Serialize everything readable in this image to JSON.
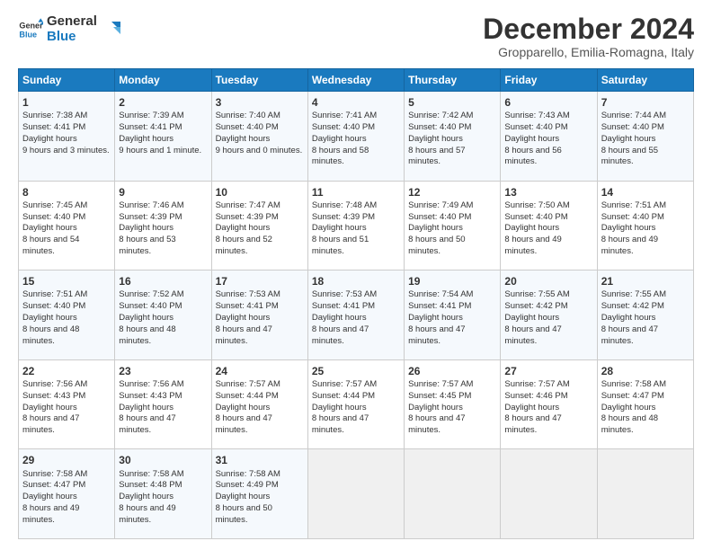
{
  "logo": {
    "line1": "General",
    "line2": "Blue"
  },
  "title": "December 2024",
  "subtitle": "Gropparello, Emilia-Romagna, Italy",
  "days": [
    "Sunday",
    "Monday",
    "Tuesday",
    "Wednesday",
    "Thursday",
    "Friday",
    "Saturday"
  ],
  "weeks": [
    [
      {
        "day": "1",
        "sunrise": "7:38 AM",
        "sunset": "4:41 PM",
        "daylight": "9 hours and 3 minutes."
      },
      {
        "day": "2",
        "sunrise": "7:39 AM",
        "sunset": "4:41 PM",
        "daylight": "9 hours and 1 minute."
      },
      {
        "day": "3",
        "sunrise": "7:40 AM",
        "sunset": "4:40 PM",
        "daylight": "9 hours and 0 minutes."
      },
      {
        "day": "4",
        "sunrise": "7:41 AM",
        "sunset": "4:40 PM",
        "daylight": "8 hours and 58 minutes."
      },
      {
        "day": "5",
        "sunrise": "7:42 AM",
        "sunset": "4:40 PM",
        "daylight": "8 hours and 57 minutes."
      },
      {
        "day": "6",
        "sunrise": "7:43 AM",
        "sunset": "4:40 PM",
        "daylight": "8 hours and 56 minutes."
      },
      {
        "day": "7",
        "sunrise": "7:44 AM",
        "sunset": "4:40 PM",
        "daylight": "8 hours and 55 minutes."
      }
    ],
    [
      {
        "day": "8",
        "sunrise": "7:45 AM",
        "sunset": "4:40 PM",
        "daylight": "8 hours and 54 minutes."
      },
      {
        "day": "9",
        "sunrise": "7:46 AM",
        "sunset": "4:39 PM",
        "daylight": "8 hours and 53 minutes."
      },
      {
        "day": "10",
        "sunrise": "7:47 AM",
        "sunset": "4:39 PM",
        "daylight": "8 hours and 52 minutes."
      },
      {
        "day": "11",
        "sunrise": "7:48 AM",
        "sunset": "4:39 PM",
        "daylight": "8 hours and 51 minutes."
      },
      {
        "day": "12",
        "sunrise": "7:49 AM",
        "sunset": "4:40 PM",
        "daylight": "8 hours and 50 minutes."
      },
      {
        "day": "13",
        "sunrise": "7:50 AM",
        "sunset": "4:40 PM",
        "daylight": "8 hours and 49 minutes."
      },
      {
        "day": "14",
        "sunrise": "7:51 AM",
        "sunset": "4:40 PM",
        "daylight": "8 hours and 49 minutes."
      }
    ],
    [
      {
        "day": "15",
        "sunrise": "7:51 AM",
        "sunset": "4:40 PM",
        "daylight": "8 hours and 48 minutes."
      },
      {
        "day": "16",
        "sunrise": "7:52 AM",
        "sunset": "4:40 PM",
        "daylight": "8 hours and 48 minutes."
      },
      {
        "day": "17",
        "sunrise": "7:53 AM",
        "sunset": "4:41 PM",
        "daylight": "8 hours and 47 minutes."
      },
      {
        "day": "18",
        "sunrise": "7:53 AM",
        "sunset": "4:41 PM",
        "daylight": "8 hours and 47 minutes."
      },
      {
        "day": "19",
        "sunrise": "7:54 AM",
        "sunset": "4:41 PM",
        "daylight": "8 hours and 47 minutes."
      },
      {
        "day": "20",
        "sunrise": "7:55 AM",
        "sunset": "4:42 PM",
        "daylight": "8 hours and 47 minutes."
      },
      {
        "day": "21",
        "sunrise": "7:55 AM",
        "sunset": "4:42 PM",
        "daylight": "8 hours and 47 minutes."
      }
    ],
    [
      {
        "day": "22",
        "sunrise": "7:56 AM",
        "sunset": "4:43 PM",
        "daylight": "8 hours and 47 minutes."
      },
      {
        "day": "23",
        "sunrise": "7:56 AM",
        "sunset": "4:43 PM",
        "daylight": "8 hours and 47 minutes."
      },
      {
        "day": "24",
        "sunrise": "7:57 AM",
        "sunset": "4:44 PM",
        "daylight": "8 hours and 47 minutes."
      },
      {
        "day": "25",
        "sunrise": "7:57 AM",
        "sunset": "4:44 PM",
        "daylight": "8 hours and 47 minutes."
      },
      {
        "day": "26",
        "sunrise": "7:57 AM",
        "sunset": "4:45 PM",
        "daylight": "8 hours and 47 minutes."
      },
      {
        "day": "27",
        "sunrise": "7:57 AM",
        "sunset": "4:46 PM",
        "daylight": "8 hours and 47 minutes."
      },
      {
        "day": "28",
        "sunrise": "7:58 AM",
        "sunset": "4:47 PM",
        "daylight": "8 hours and 48 minutes."
      }
    ],
    [
      {
        "day": "29",
        "sunrise": "7:58 AM",
        "sunset": "4:47 PM",
        "daylight": "8 hours and 49 minutes."
      },
      {
        "day": "30",
        "sunrise": "7:58 AM",
        "sunset": "4:48 PM",
        "daylight": "8 hours and 49 minutes."
      },
      {
        "day": "31",
        "sunrise": "7:58 AM",
        "sunset": "4:49 PM",
        "daylight": "8 hours and 50 minutes."
      },
      null,
      null,
      null,
      null
    ]
  ]
}
